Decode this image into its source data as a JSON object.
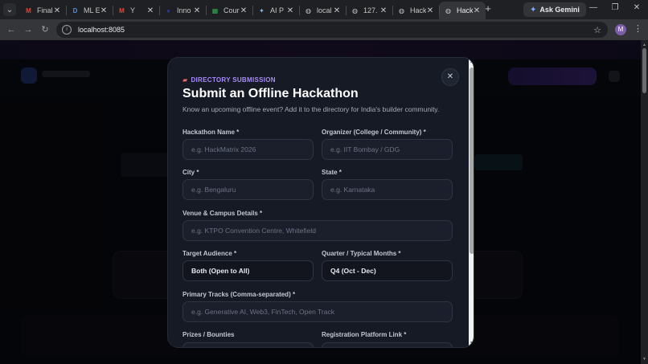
{
  "browser": {
    "tabs": [
      {
        "title": "Final",
        "icon": "gmail-icon",
        "favicon": "M",
        "color": "#ea4335"
      },
      {
        "title": "ML E",
        "icon": "d-logo-icon",
        "favicon": "D",
        "color": "#4a90e2"
      },
      {
        "title": "Y",
        "icon": "gmail-icon",
        "favicon": "M",
        "color": "#ea4335"
      },
      {
        "title": "Inno",
        "icon": "globe-dark-icon",
        "favicon": "●",
        "color": "#2b3a8f"
      },
      {
        "title": "Cour",
        "icon": "sheet-icon",
        "favicon": "▦",
        "color": "#34a853"
      },
      {
        "title": "AI P",
        "icon": "sparkle-icon",
        "favicon": "✦",
        "color": "#8ab4f8"
      },
      {
        "title": "local",
        "icon": "globe-icon",
        "favicon": "◍",
        "color": "#c4c7c5"
      },
      {
        "title": "127.",
        "icon": "globe-icon",
        "favicon": "◍",
        "color": "#c4c7c5"
      },
      {
        "title": "Hack",
        "icon": "globe-icon",
        "favicon": "◍",
        "color": "#c4c7c5"
      },
      {
        "title": "Hack",
        "icon": "globe-icon",
        "favicon": "◍",
        "color": "#c4c7c5",
        "active": true
      }
    ],
    "new_tab": "+",
    "gemini_label": "Ask Gemini",
    "url": "localhost:8085",
    "profile_initial": "M"
  },
  "modal": {
    "eyebrow": "DIRECTORY SUBMISSION",
    "title": "Submit an Offline Hackathon",
    "subtitle": "Know an upcoming offline event? Add it to the directory for India's builder community.",
    "close": "✕",
    "fields": {
      "name": {
        "label": "Hackathon Name *",
        "placeholder": "e.g. HackMatrix 2026"
      },
      "organizer": {
        "label": "Organizer (College / Community) *",
        "placeholder": "e.g. IIT Bombay / GDG"
      },
      "city": {
        "label": "City *",
        "placeholder": "e.g. Bengaluru"
      },
      "state": {
        "label": "State *",
        "placeholder": "e.g. Karnataka"
      },
      "venue": {
        "label": "Venue & Campus Details *",
        "placeholder": "e.g. KTPO Convention Centre, Whitefield"
      },
      "audience": {
        "label": "Target Audience *",
        "value": "Both (Open to All)"
      },
      "quarter": {
        "label": "Quarter / Typical Months *",
        "value": "Q4 (Oct - Dec)"
      },
      "tracks": {
        "label": "Primary Tracks (Comma-separated) *",
        "placeholder": "e.g. Generative AI, Web3, FinTech, Open Track"
      },
      "prizes": {
        "label": "Prizes / Bounties"
      },
      "registration": {
        "label": "Registration Platform Link *"
      }
    }
  }
}
